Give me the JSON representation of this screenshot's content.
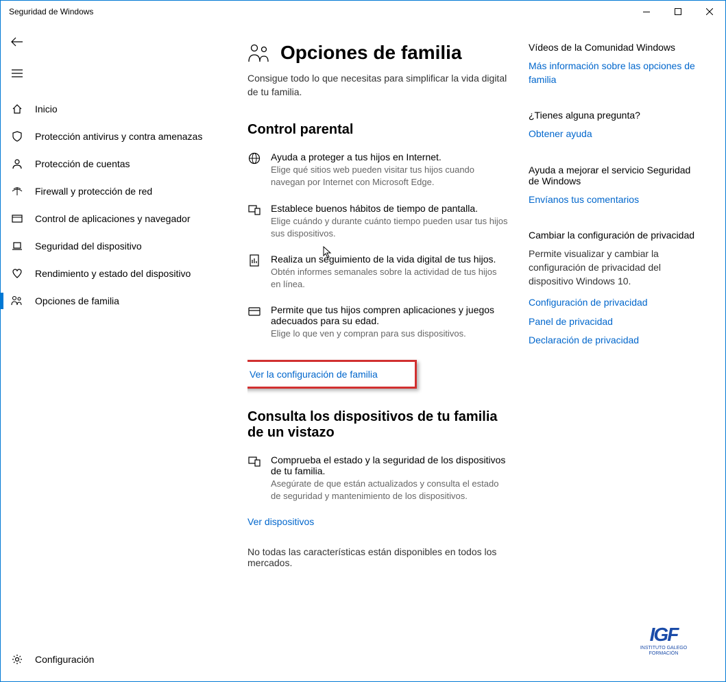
{
  "window": {
    "title": "Seguridad de Windows"
  },
  "nav": {
    "items": [
      {
        "label": "Inicio"
      },
      {
        "label": "Protección antivirus y contra amenazas"
      },
      {
        "label": "Protección de cuentas"
      },
      {
        "label": "Firewall y protección de red"
      },
      {
        "label": "Control de aplicaciones y navegador"
      },
      {
        "label": "Seguridad del dispositivo"
      },
      {
        "label": "Rendimiento y estado del dispositivo"
      },
      {
        "label": "Opciones de familia"
      }
    ],
    "settings": "Configuración"
  },
  "page": {
    "title": "Opciones de familia",
    "subtitle": "Consigue todo lo que necesitas para simplificar la vida digital de tu familia."
  },
  "parental": {
    "heading": "Control parental",
    "items": [
      {
        "title": "Ayuda a proteger a tus hijos en Internet.",
        "desc": "Elige qué sitios web pueden visitar tus hijos cuando navegan por Internet con Microsoft Edge."
      },
      {
        "title": "Establece buenos hábitos de tiempo de pantalla.",
        "desc": "Elige cuándo y durante cuánto tiempo pueden usar tus hijos sus dispositivos."
      },
      {
        "title": "Realiza un seguimiento de la vida digital de tus hijos.",
        "desc": "Obtén informes semanales sobre la actividad de tus hijos en línea."
      },
      {
        "title": "Permite que tus hijos compren aplicaciones y juegos adecuados para su edad.",
        "desc": "Elige lo que ven y compran para sus dispositivos."
      }
    ],
    "link": "Ver la configuración de familia"
  },
  "devices": {
    "heading": "Consulta los dispositivos de tu familia de un vistazo",
    "item": {
      "title": "Comprueba el estado y la seguridad de los dispositivos de tu familia.",
      "desc": "Asegúrate de que están actualizados y consulta el estado de seguridad y mantenimiento de los dispositivos."
    },
    "link": "Ver dispositivos"
  },
  "disclaimer": "No todas las características están disponibles en todos los mercados.",
  "aside": {
    "community": {
      "title": "Vídeos de la Comunidad Windows",
      "link": "Más información sobre las opciones de familia"
    },
    "help": {
      "title": "¿Tienes alguna pregunta?",
      "link": "Obtener ayuda"
    },
    "improve": {
      "title": "Ayuda a mejorar el servicio Seguridad de Windows",
      "link": "Envíanos tus comentarios"
    },
    "privacy": {
      "title": "Cambiar la configuración de privacidad",
      "desc": "Permite visualizar y cambiar la configuración de privacidad del dispositivo Windows 10.",
      "links": [
        "Configuración de privacidad",
        "Panel de privacidad",
        "Declaración de privacidad"
      ]
    }
  },
  "logo": {
    "main": "IGF",
    "sub1": "INSTITUTO GALEGO",
    "sub2": "FORMACIÓN"
  }
}
